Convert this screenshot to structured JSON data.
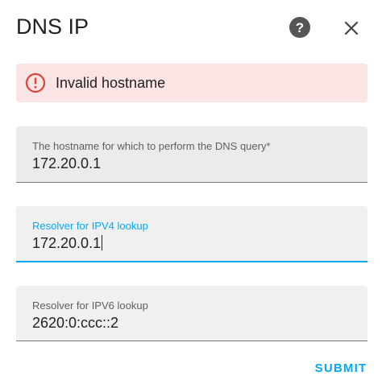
{
  "dialog": {
    "title": "DNS IP",
    "help_icon": "help-circle-icon",
    "close_icon": "close-icon"
  },
  "error": {
    "icon": "alert-circle-outline-icon",
    "message": "Invalid hostname",
    "color": "#db4437",
    "background": "#fbe4e4"
  },
  "fields": [
    {
      "label": "The hostname for which to perform the DNS query*",
      "value": "172.20.0.1"
    },
    {
      "label": "Resolver for IPV4 lookup",
      "value": "172.20.0.1",
      "focused": true
    },
    {
      "label": "Resolver for IPV6 lookup",
      "value": "2620:0:ccc::2"
    }
  ],
  "actions": {
    "submit_label": "SUBMIT"
  },
  "colors": {
    "accent": "#03a9f4",
    "text": "#212121",
    "secondary_text": "#5f5f5f"
  }
}
